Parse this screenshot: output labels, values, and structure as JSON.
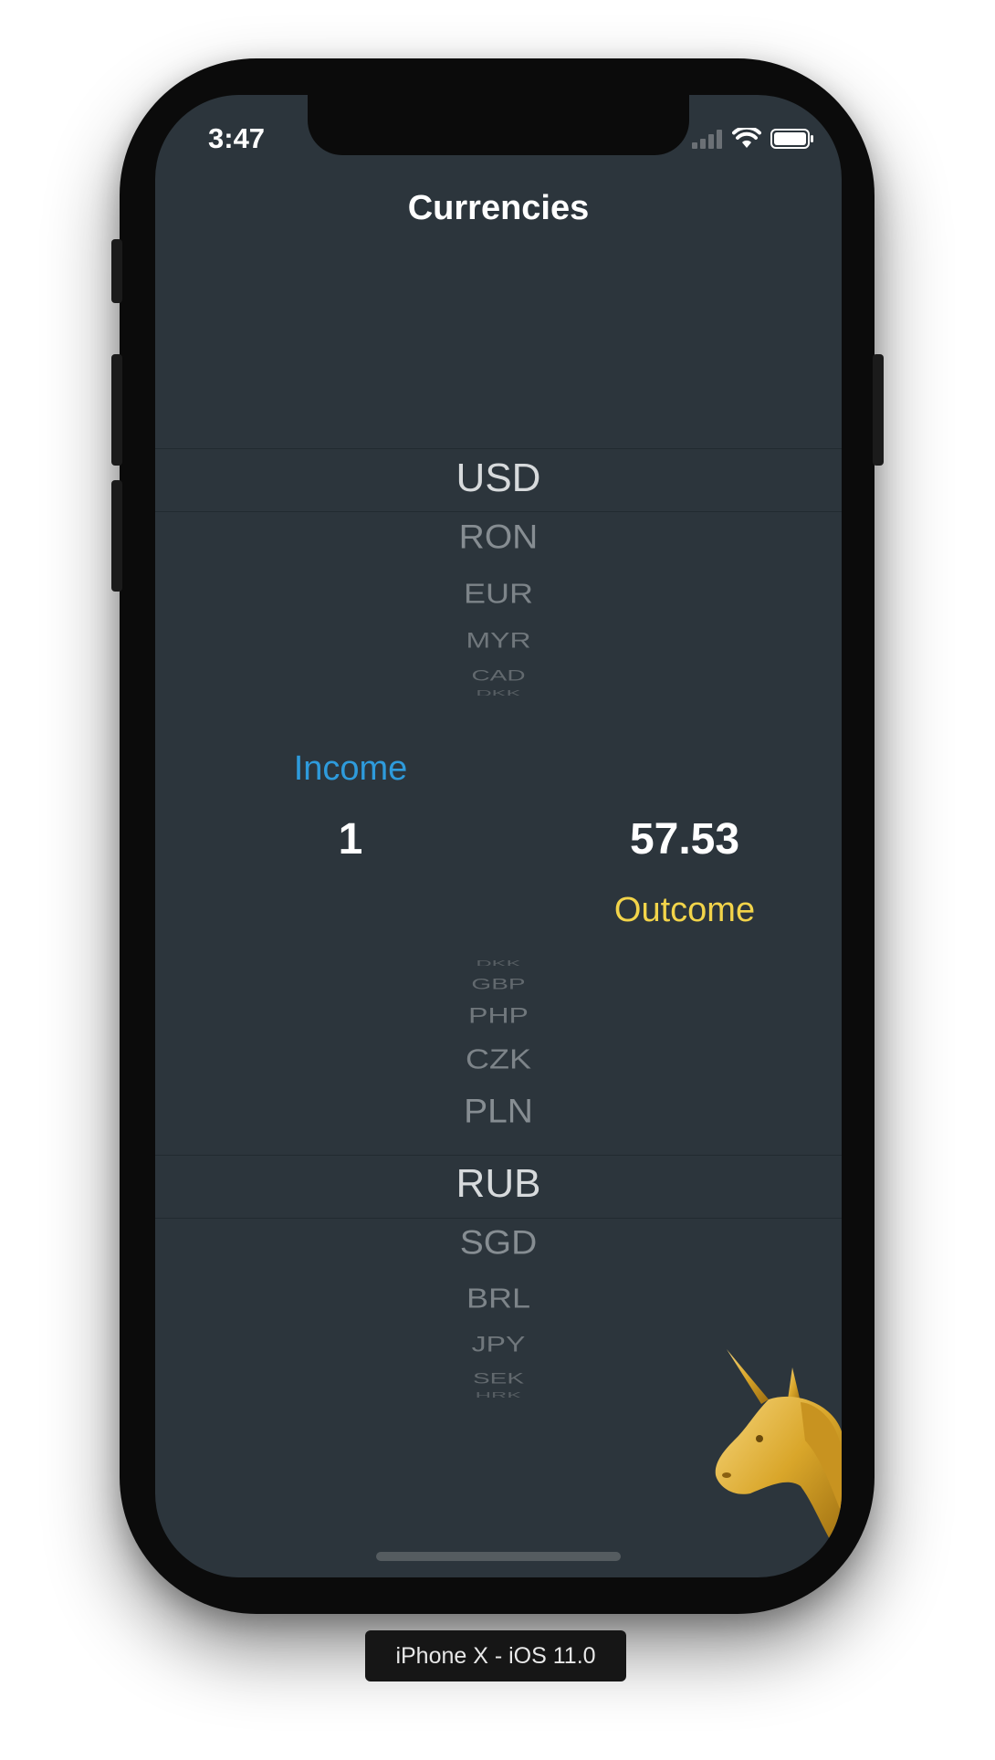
{
  "status_bar": {
    "time": "3:47",
    "icons": [
      "signal-icon",
      "wifi-icon",
      "battery-icon"
    ]
  },
  "nav": {
    "title": "Currencies"
  },
  "top_picker": {
    "selected": "USD",
    "below": [
      "RON",
      "EUR",
      "MYR",
      "CAD",
      "DKK"
    ]
  },
  "income": {
    "label": "Income",
    "value": "1",
    "color": "#2e9bdc"
  },
  "outcome": {
    "label": "Outcome",
    "value": "57.53",
    "color": "#f2d44a"
  },
  "bottom_picker": {
    "above": [
      "DKK",
      "GBP",
      "PHP",
      "CZK",
      "PLN"
    ],
    "selected": "RUB",
    "below": [
      "SGD",
      "BRL",
      "JPY",
      "SEK",
      "HRK"
    ]
  },
  "device_label": "iPhone X - iOS 11.0",
  "colors": {
    "screen_bg": "#2c353c",
    "picker_selected": "#d7dadc",
    "picker_dim": "#8a9196"
  }
}
